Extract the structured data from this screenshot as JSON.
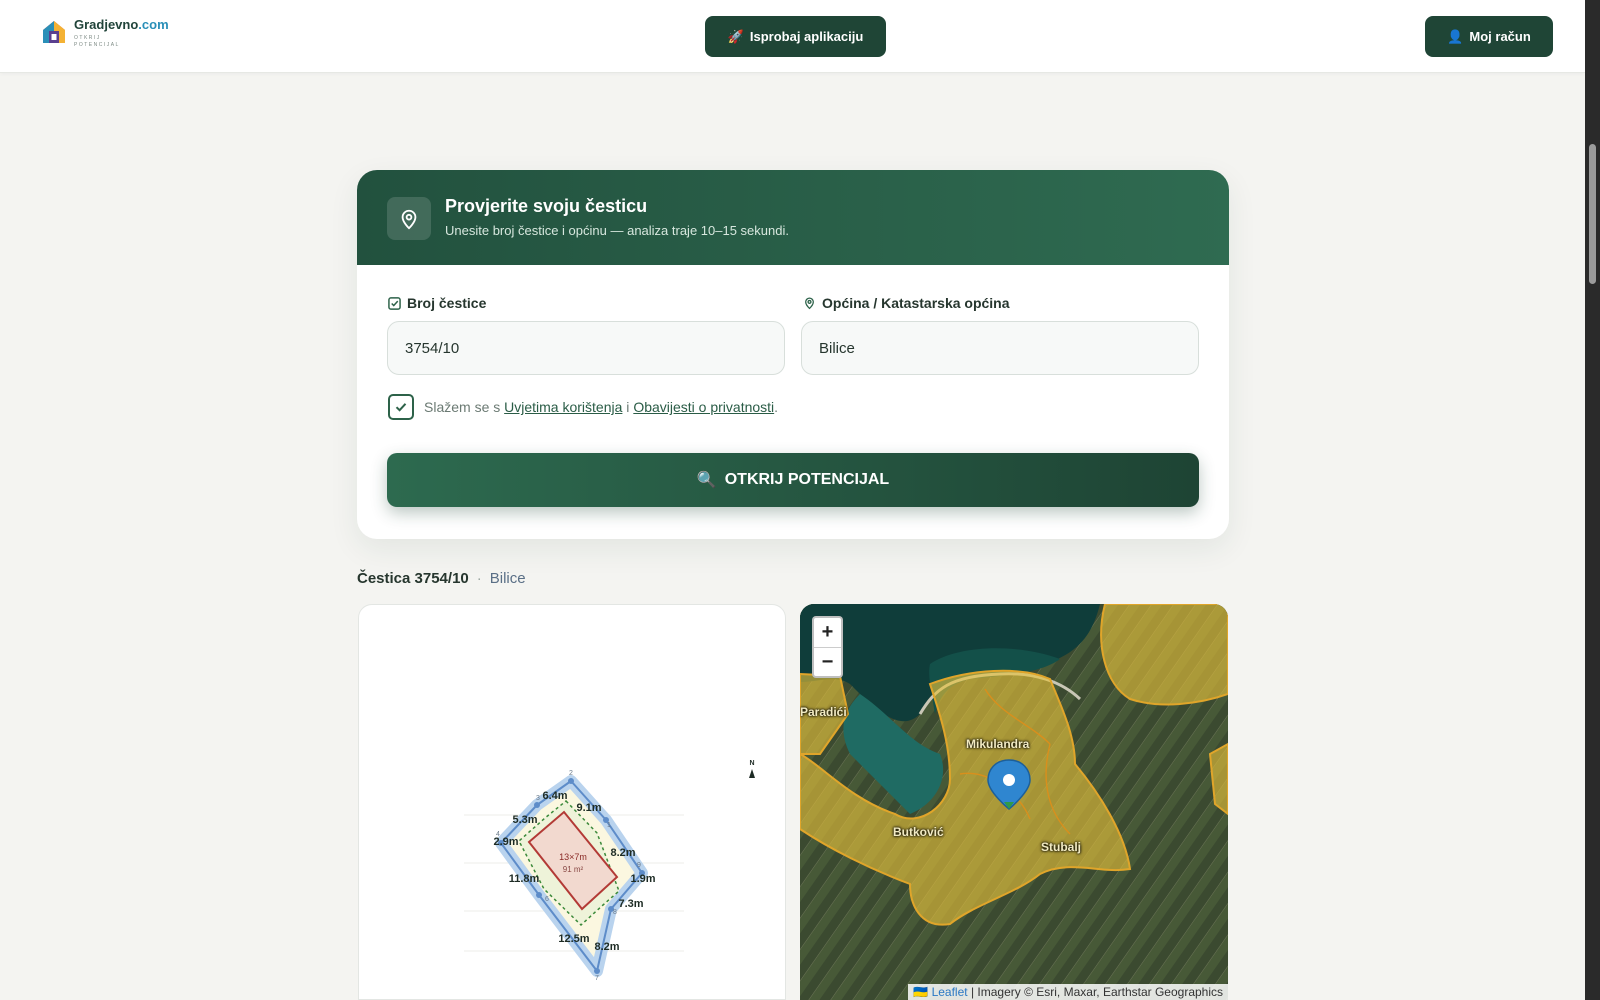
{
  "header": {
    "logo_name": "Gradjevno",
    "logo_domain": ".com",
    "logo_tagline_1": "OTKRIJ",
    "logo_tagline_2": "POTENCIJAL",
    "try_app_label": "Isprobaj aplikaciju",
    "try_app_icon": "rocket-icon",
    "account_label": "Moj račun",
    "account_icon": "user-icon"
  },
  "card": {
    "title": "Provjerite svoju česticu",
    "subtitle": "Unesite broj čestice i općinu — analiza traje 10–15 sekundi.",
    "parcel_label": "Broj čestice",
    "parcel_value": "3754/10",
    "municipality_label": "Općina / Katastarska općina",
    "municipality_value": "Bilice",
    "agree_prefix": "Slažem se s",
    "agree_terms": "Uvjetima korištenja",
    "agree_and": "i",
    "agree_privacy": "Obavijesti o privatnosti",
    "agree_suffix": ".",
    "agree_checked": true,
    "submit_label": "OTKRIJ POTENCIJAL",
    "submit_icon": "search-icon"
  },
  "result": {
    "parcel_title": "Čestica 3754/10",
    "separator": "·",
    "place": "Bilice"
  },
  "plot": {
    "north": "N",
    "building_dims": "13×7m",
    "building_area": "91 m²",
    "side_labels": [
      "6.4m",
      "9.1m",
      "5.3m",
      "2.9m",
      "8.2m",
      "11.8m",
      "1.9m",
      "7.3m",
      "12.5m",
      "8.2m"
    ],
    "vertex_labels": [
      "2",
      "3",
      "1",
      "4",
      "9",
      "6",
      "8",
      "7"
    ]
  },
  "map": {
    "zoom_in": "+",
    "zoom_out": "−",
    "labels": [
      "Mikulandra",
      "Butković",
      "Stubalj",
      "Paradići"
    ],
    "attribution_leaflet": "Leaflet",
    "attribution_rest": "| Imagery © Esri, Maxar, Earthstar Geographics"
  },
  "colors": {
    "brand_dark": "#1f4536",
    "brand": "#2d6a4f",
    "zone_fill": "#e9c13a",
    "marker": "#2f86d0"
  }
}
